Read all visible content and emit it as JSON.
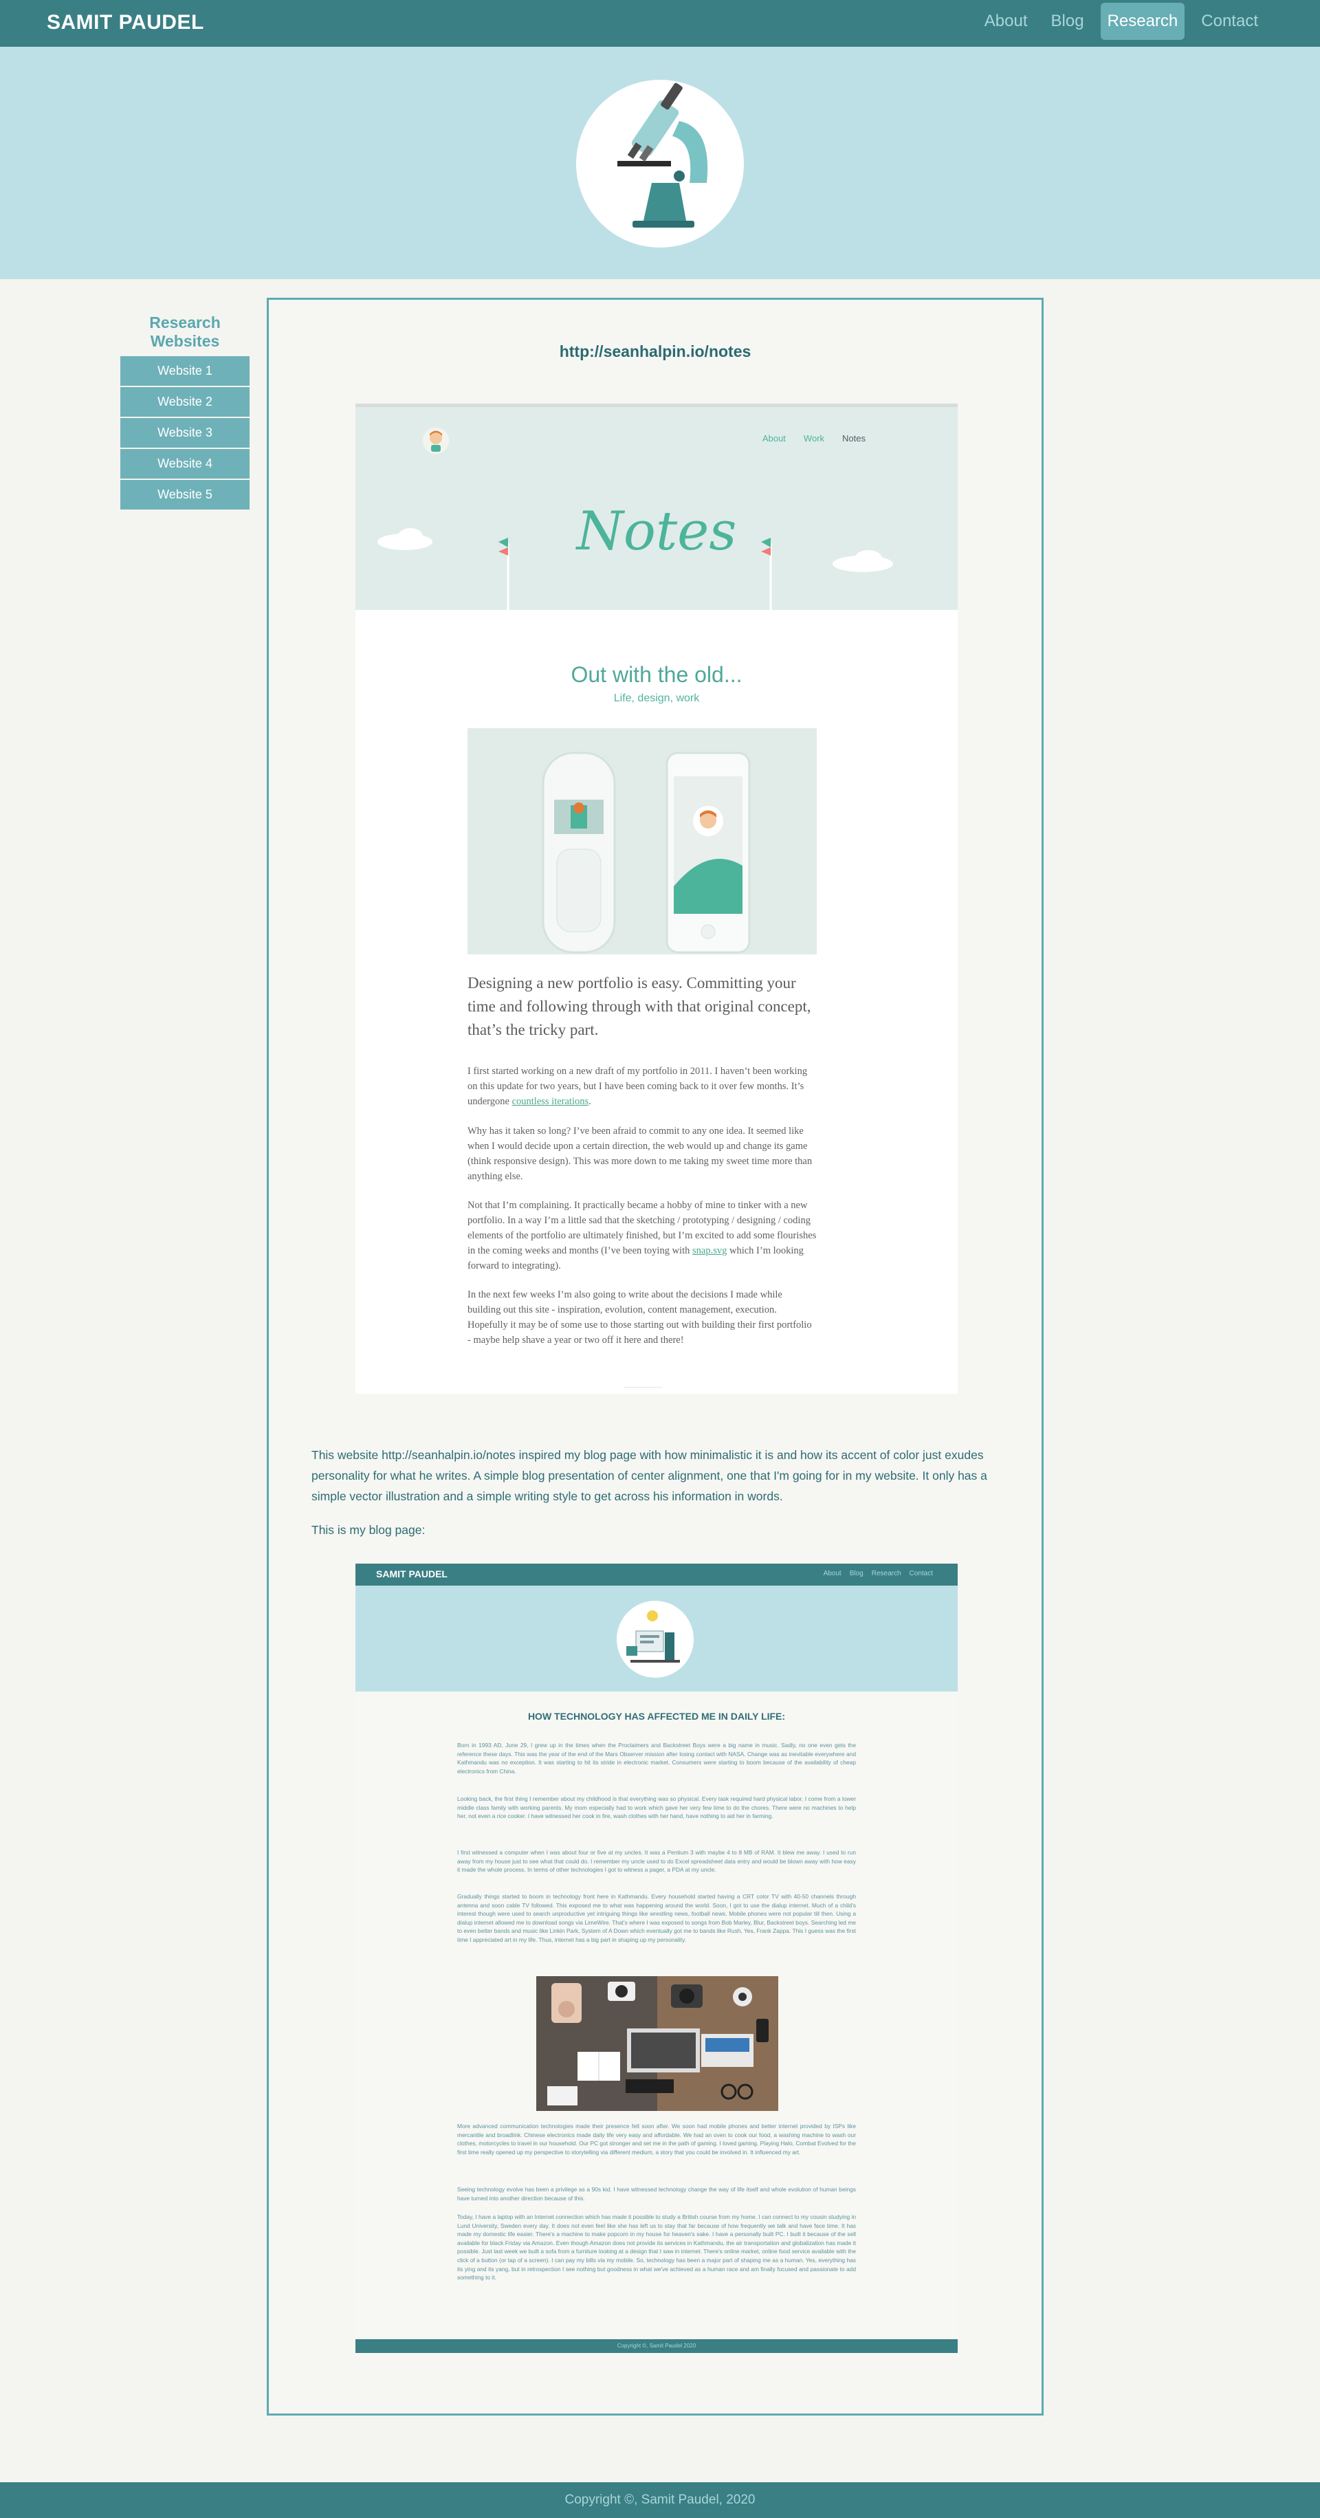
{
  "header": {
    "brand": "SAMIT PAUDEL",
    "nav": [
      {
        "label": "About"
      },
      {
        "label": "Blog"
      },
      {
        "label": "Research"
      },
      {
        "label": "Contact"
      }
    ]
  },
  "hero": {
    "icon": "microscope-icon"
  },
  "sidebar": {
    "title": "Research Websites",
    "items": [
      {
        "label": "Website 1"
      },
      {
        "label": "Website 2"
      },
      {
        "label": "Website 3"
      },
      {
        "label": "Website 4"
      },
      {
        "label": "Website 5"
      }
    ]
  },
  "main": {
    "url_heading": "http://seanhalpin.io/notes",
    "shot1": {
      "nav": [
        "About",
        "Work",
        "Notes"
      ],
      "notes_title": "Notes",
      "post_title": "Out with the old...",
      "post_subtitle": "Life, design, work",
      "lead": "Designing a new portfolio is easy. Committing your time and following through with that original concept, that’s the tricky part.",
      "p1_a": "I first started working on a new draft of my portfolio in 2011. I haven’t been working on this update for two years, but I have been coming back to it over few months. It’s undergone ",
      "p1_link": "countless iterations",
      "p1_b": ".",
      "p2": "Why has it taken so long? I’ve been afraid to commit to any one idea. It seemed like when I would decide upon a certain direction, the web would up and change its game (think responsive design). This was more down to me taking my sweet time more than anything else.",
      "p3_a": "Not that I’m complaining. It practically became a hobby of mine to tinker with a new portfolio. In a way I’m a little sad that the sketching / prototyping / designing / coding elements of the portfolio are ultimately finished, but I’m excited to add some flourishes in the coming weeks and months (I’ve been toying with ",
      "p3_link": "snap.svg",
      "p3_b": " which I’m looking forward to integrating).",
      "p4": "In the next few weeks I’m also going to write about the decisions I made while building out this site - inspiration, evolution, content management, execution. Hopefully it may be of some use to those starting out with building their first portfolio - maybe help shave a year or two off it here and there!"
    },
    "description": "This website http://seanhalpin.io/notes inspired my blog page with how minimalistic it is and how its accent of color just exudes personality for what he writes. A simple blog presentation of center alignment, one that I'm going for in my website. It only has a simple vector illustration and a simple writing style to get across his information in words.",
    "blog_intro": "This is my blog page:",
    "shot2": {
      "brand": "SAMIT PAUDEL",
      "nav": [
        "About",
        "Blog",
        "Research",
        "Contact"
      ],
      "heading": "HOW TECHNOLOGY HAS AFFECTED ME IN DAILY LIFE:",
      "p1": "Born in 1993 AD, June 29, I grew up in the times when the Proclaimers and Backstreet Boys were a big name in music. Sadly, no one even gets the reference these days. This was the year of the end of the Mars Observer mission after losing contact with NASA. Change was as inevitable everywhere and Kathmandu was no exception. It was starting to hit its stride in electronic market. Consumers were starting to boom because of the availability of cheap electronics from China.",
      "p2": "Looking back, the first thing I remember about my childhood is that everything was so physical. Every task required hard physical labor. I come from a lower middle class family with working parents. My mom especially had to work which gave her very few time to do the chores. There were no machines to help her, not even a rice cooker. I have witnessed her cook in fire, wash clothes with her hand, have nothing to aid her in farming.",
      "p3": "I first witnessed a computer when I was about four or five at my uncles. It was a Pentium 3 with maybe 4 to 8 MB of RAM. It blew me away. I used to run away from my house just to see what that could do. I remember my uncle used to do Excel spreadsheet data entry and would be blown away with how easy it made the whole process. In terms of other technologies I got to witness a pager, a PDA at my uncle.",
      "p4": "Gradually things started to boom in technology front here in Kathmandu. Every household started having a CRT color TV with 40-50 channels through antenna and soon cable TV followed. This exposed me to what was happening around the world. Soon, I got to use the dialup internet. Much of a child's interest though were used to search unproductive yet intriguing things like wrestling news, football news. Mobile phones were not popular till then. Using a dialup internet allowed me to download songs via LimeWire. That's where I was exposed to songs from Bob Marley, Blur, Backstreet boys. Searching led me to even better bands and music like Linkin Park, System of A Down which eventually got me to bands like Rush, Yes, Frank Zappa. This I guess was the first time I appreciated art in my life. Thus, internet has a big part in shaping up my personality.",
      "p5": "More advanced communication technologies made their presence felt soon after. We soon had mobile phones and better internet provided by ISPs like mercantile and broadlink. Chinese electronics made daily life very easy and affordable. We had an oven to cook our food, a washing machine to wash our clothes, motorcycles to travel in our household. Our PC got stronger and set me in the path of gaming. I loved gaming. Playing Halo, Combat Evolved for the first time really opened up my perspective to storytelling via different medium, a story that you could be involved in. It influenced my art.",
      "p6": "Seeing technology evolve has been a privilege as a 90s kid. I have witnessed technology change the way of life itself and whole evolution of human beings have turned into another direction because of this.",
      "p7": "Today, I have a laptop with an Internet connection which has made it possible to study a British course from my home. I can connect to my cousin studying in Lund University, Sweden every day. It does not even feel like she has left us to stay that far because of how frequently we talk and have face time. It has made my domestic life easier. There's a machine to make popcorn in my house for heaven's sake. I have a personally built PC. I built it because of the sell available for black Friday via Amazon. Even though Amazon does not provide its services in Kathmandu, the air transportation and globalization has made it possible. Just last week we built a sofa from a furniture looking at a design that I saw in internet. There's online market, online food service available with the click of a button (or tap of a screen). I can pay my bills via my mobile. So, technology has been a major part of shaping me as a human. Yes, everything has its ying and its yang, but in retrospection I see nothing but goodness in what we've achieved as a human race and am finally focused and passionate to add something to it.",
      "footer": "Copyright ©, Samit Paudel 2020"
    }
  },
  "footer": {
    "text": "Copyright ©, Samit Paudel, 2020"
  },
  "colors": {
    "teal_dark": "#3a7f84",
    "hero_bg": "#bde0e6",
    "accent": "#6fb1b8",
    "page_bg": "#f4f4f0"
  }
}
